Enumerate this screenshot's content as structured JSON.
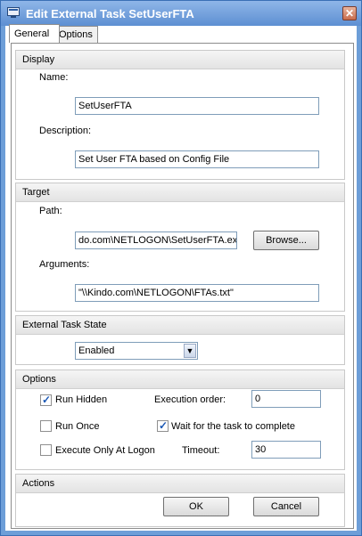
{
  "window": {
    "title": "Edit External Task SetUserFTA",
    "title_icon": "task-icon",
    "close_icon": "close-icon"
  },
  "tabs": [
    {
      "label": "General",
      "selected": true
    },
    {
      "label": "Options",
      "selected": false
    }
  ],
  "display": {
    "header": "Display",
    "name_label": "Name:",
    "name_value": "SetUserFTA",
    "description_label": "Description:",
    "description_value": "Set User FTA based on Config File"
  },
  "target": {
    "header": "Target",
    "path_label": "Path:",
    "path_value": "do.com\\NETLOGON\\SetUserFTA.exe",
    "browse_label": "Browse...",
    "arguments_label": "Arguments:",
    "arguments_value": "\"\\\\Kindo.com\\NETLOGON\\FTAs.txt\""
  },
  "state": {
    "header": "External Task State",
    "selected": "Enabled"
  },
  "options": {
    "header": "Options",
    "run_hidden_label": "Run Hidden",
    "run_hidden_checked": true,
    "execution_order_label": "Execution order:",
    "execution_order_value": "0",
    "run_once_label": "Run Once",
    "run_once_checked": false,
    "wait_label": "Wait for the task to complete",
    "wait_checked": true,
    "logon_label": "Execute Only At Logon",
    "logon_checked": false,
    "timeout_label": "Timeout:",
    "timeout_value": "30"
  },
  "actions": {
    "header": "Actions",
    "ok_label": "OK",
    "cancel_label": "Cancel"
  }
}
